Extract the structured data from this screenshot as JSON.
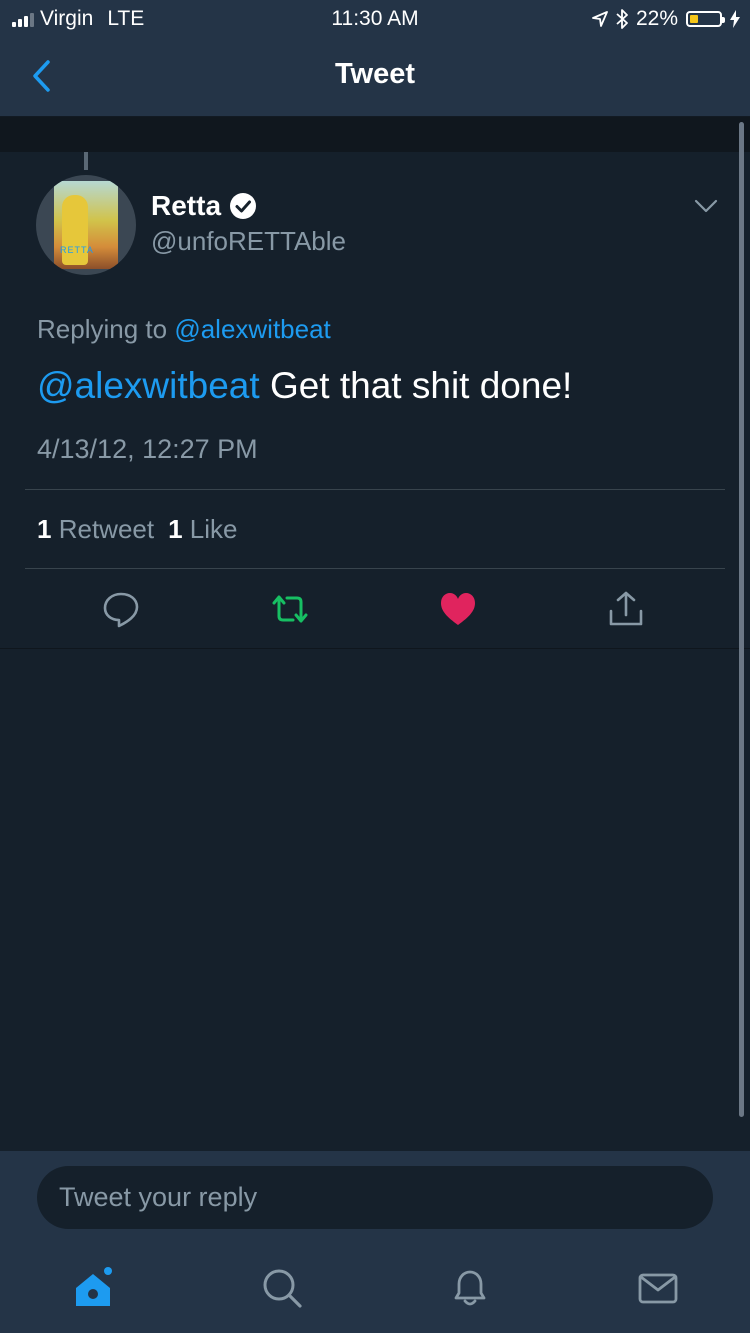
{
  "status_bar": {
    "carrier": "Virgin",
    "network": "LTE",
    "time": "11:30 AM",
    "battery": "22%",
    "battery_level": 0.22
  },
  "nav": {
    "title": "Tweet"
  },
  "tweet": {
    "display_name": "Retta",
    "handle": "@unfoRETTAble",
    "replying_prefix": "Replying to",
    "replying_to": "@alexwitbeat",
    "mention": "@alexwitbeat",
    "text": " Get that shit done!",
    "timestamp": "4/13/12, 12:27 PM",
    "retweet_count": "1",
    "retweet_label": "Retweet",
    "like_count": "1",
    "like_label": "Like",
    "avatar_text": "RETTA"
  },
  "reply": {
    "placeholder": "Tweet your reply"
  },
  "colors": {
    "accent": "#1d9bf0",
    "retweet_green": "#17bf63",
    "like_red": "#e0245e",
    "background": "#15202b",
    "bar_background": "#243447"
  }
}
